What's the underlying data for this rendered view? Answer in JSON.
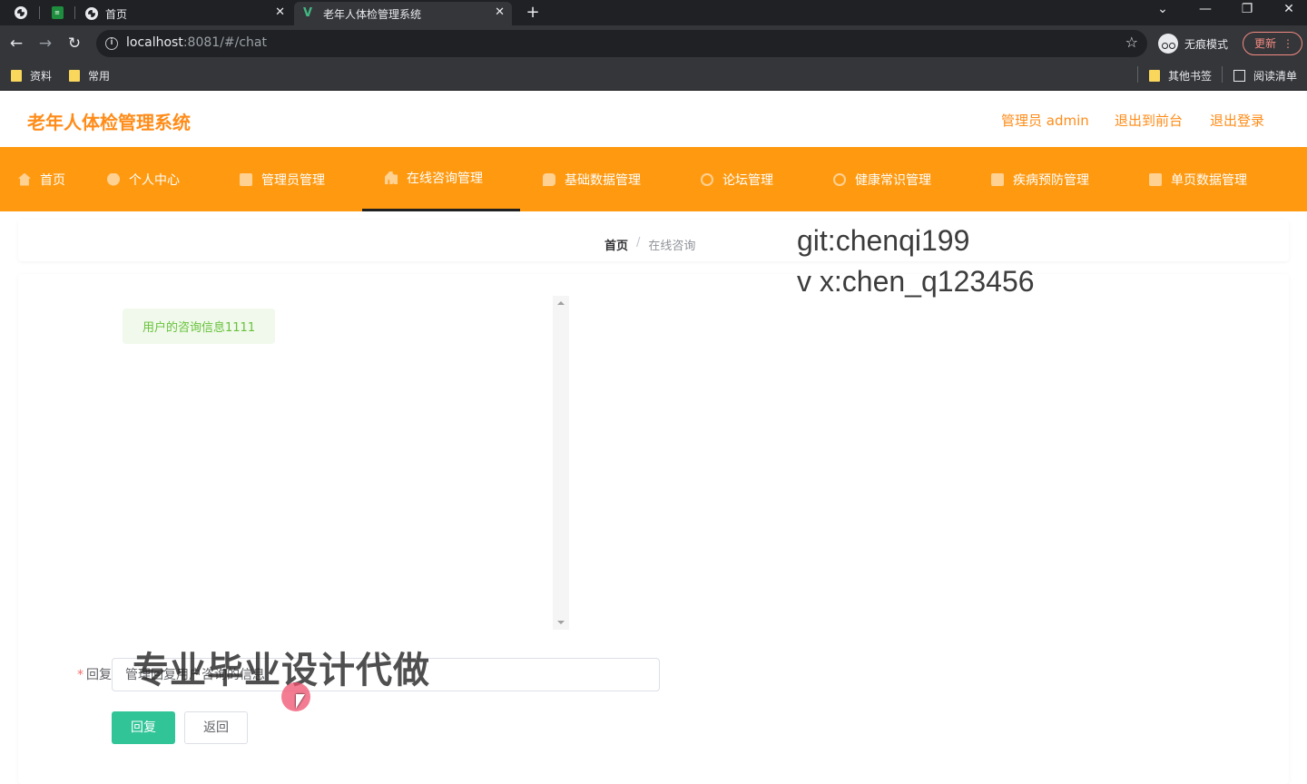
{
  "browser": {
    "tabs": [
      {
        "title": "首页",
        "close": "✕"
      },
      {
        "title": "老年人体检管理系统",
        "close": "✕"
      }
    ],
    "new_tab": "+",
    "window_controls": {
      "dropdown": "⌄",
      "minimize": "—",
      "restore": "❐",
      "close": "✕"
    },
    "url_host": "localhost",
    "url_rest": ":8081/#/chat",
    "incognito_label": "无痕模式",
    "update_label": "更新",
    "bookmarks": [
      {
        "label": "资料",
        "icon": "folder-icon"
      },
      {
        "label": "常用",
        "icon": "folder-icon"
      },
      {
        "label": "其他书签",
        "icon": "folder-icon"
      },
      {
        "label": "阅读清单",
        "icon": "reading-list-icon"
      }
    ]
  },
  "app": {
    "title": "老年人体检管理系统",
    "header_links": {
      "admin": "管理员 admin",
      "back_front": "退出到前台",
      "logout": "退出登录"
    },
    "menu": [
      {
        "label": "首页",
        "icon": "home-icon"
      },
      {
        "label": "个人中心",
        "icon": "user-icon"
      },
      {
        "label": "管理员管理",
        "icon": "admin-icon"
      },
      {
        "label": "在线咨询管理",
        "icon": "chart-icon",
        "active": true
      },
      {
        "label": "基础数据管理",
        "icon": "chat-icon"
      },
      {
        "label": "论坛管理",
        "icon": "forum-icon"
      },
      {
        "label": "健康常识管理",
        "icon": "knowledge-icon"
      },
      {
        "label": "疾病预防管理",
        "icon": "prevention-icon"
      },
      {
        "label": "单页数据管理",
        "icon": "page-icon"
      }
    ],
    "breadcrumb": {
      "home": "首页",
      "separator": "/",
      "current": "在线咨询"
    },
    "chat": {
      "messages": [
        "用户的咨询信息1111"
      ]
    },
    "form": {
      "required_mark": "*",
      "reply_label": "回复",
      "reply_value": "管理回复用户咨询的信息",
      "reply_button": "回复",
      "back_button": "返回"
    },
    "accent_color": "#ff9a10",
    "title_color": "#ff8c19",
    "button_color": "#30c497"
  },
  "overlays": {
    "watermark_git": "git:chenqi199",
    "watermark_vx": "v x:chen_q123456",
    "watermark_cn": "专业毕业设计代做"
  }
}
